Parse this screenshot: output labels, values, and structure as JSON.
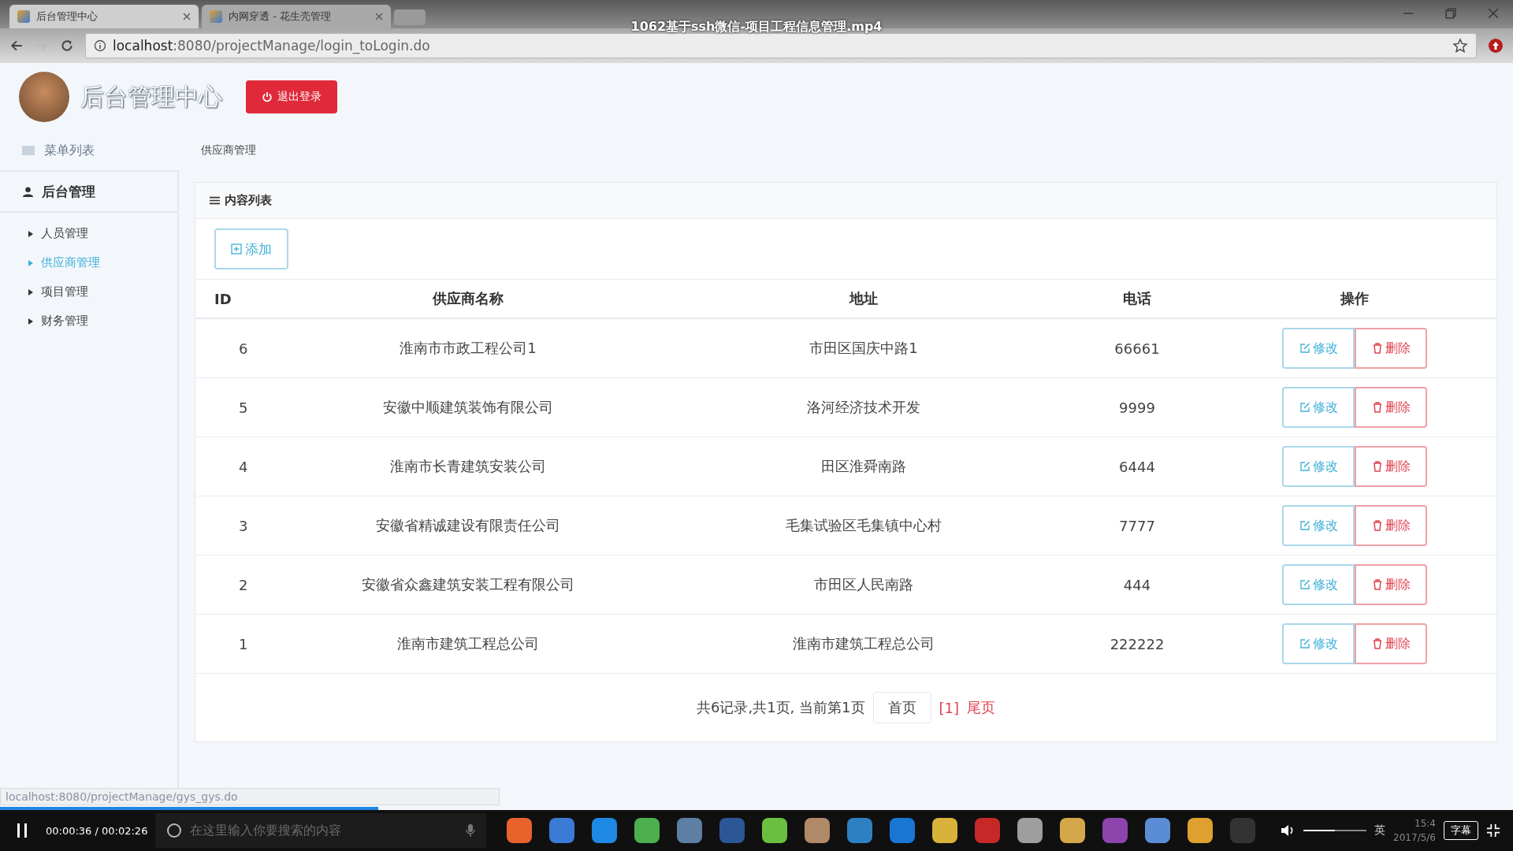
{
  "video_title": "1062基于ssh微信-项目工程信息管理.mp4",
  "browser": {
    "tabs": [
      {
        "title": "后台管理中心",
        "selected": true
      },
      {
        "title": "内网穿透 - 花生壳管理",
        "selected": false
      }
    ],
    "url_host": "localhost",
    "url_rest": ":8080/projectManage/login_toLogin.do"
  },
  "header": {
    "title": "后台管理中心",
    "logout_label": "退出登录"
  },
  "sidebar": {
    "heading": "菜单列表",
    "group": "后台管理",
    "items": [
      {
        "label": "人员管理",
        "selected": false
      },
      {
        "label": "供应商管理",
        "selected": true
      },
      {
        "label": "项目管理",
        "selected": false
      },
      {
        "label": "财务管理",
        "selected": false
      }
    ]
  },
  "breadcrumb": "供应商管理",
  "panel": {
    "title": "内容列表",
    "add_label": "添加"
  },
  "table": {
    "columns": [
      "ID",
      "供应商名称",
      "地址",
      "电话",
      "操作"
    ],
    "rows": [
      {
        "id": "6",
        "name": "淮南市市政工程公司1",
        "address": "市田区国庆中路1",
        "phone": "66661",
        "edit": "修改",
        "delete": "删除"
      },
      {
        "id": "5",
        "name": "安徽中顺建筑装饰有限公司",
        "address": "洛河经济技术开发",
        "phone": "9999",
        "edit": "修改",
        "delete": "删除"
      },
      {
        "id": "4",
        "name": "淮南市长青建筑安装公司",
        "address": "田区淮舜南路",
        "phone": "6444",
        "edit": "修改",
        "delete": "删除"
      },
      {
        "id": "3",
        "name": "安徽省精诚建设有限责任公司",
        "address": "毛集试验区毛集镇中心村",
        "phone": "7777",
        "edit": "修改",
        "delete": "删除"
      },
      {
        "id": "2",
        "name": "安徽省众鑫建筑安装工程有限公司",
        "address": "市田区人民南路",
        "phone": "444",
        "edit": "修改",
        "delete": "删除"
      },
      {
        "id": "1",
        "name": "淮南市建筑工程总公司",
        "address": "淮南市建筑工程总公司",
        "phone": "222222",
        "edit": "修改",
        "delete": "删除"
      }
    ]
  },
  "pagination": {
    "summary": "共6记录,共1页, 当前第1页",
    "first": "首页",
    "current": "[1]",
    "last": "尾页"
  },
  "status_url": "localhost:8080/projectManage/gys_gys.do",
  "player": {
    "seek": {
      "level": 0.25
    },
    "time": "00:00:36 / 00:02:26",
    "volume": {
      "level": 0.5
    },
    "caption_label": "字幕"
  },
  "taskbar": {
    "search_placeholder": "在这里输入你要搜索的内容",
    "ime": "英",
    "clock_time": "15:4",
    "clock_date": "2017/5/6"
  }
}
